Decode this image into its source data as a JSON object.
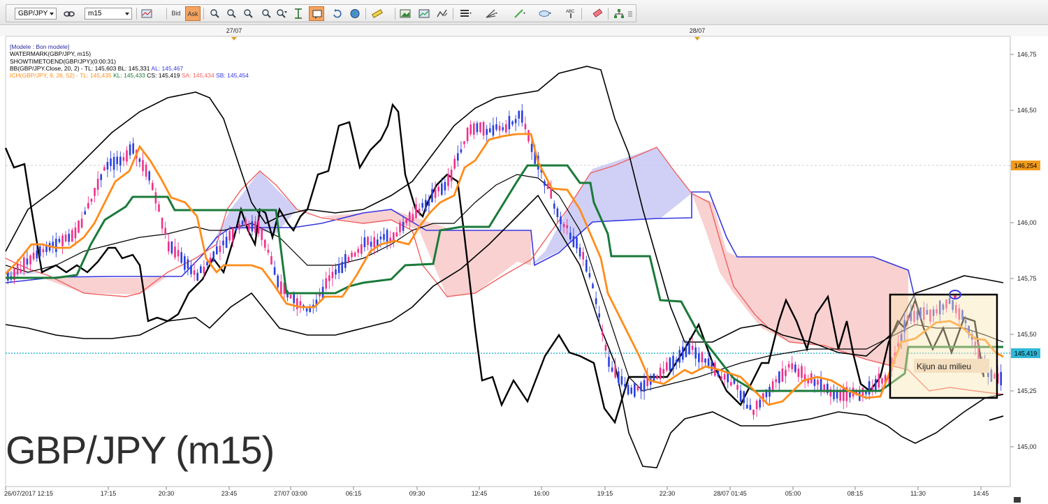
{
  "toolbar": {
    "symbol": "GBP/JPY",
    "timeframe": "m15",
    "bid_label": "Bid",
    "ask_label": "Ask"
  },
  "legend": {
    "line1": "[Modele : Bon modele]",
    "line2": "WATERMARK(GBP/JPY, m15)",
    "line3": "SHOWTIMETOEND(GBP/JPY)(0:00:31)",
    "bb_prefix": "BB(GBP/JPY.Close, 20, 2) -  TL: 145,603  BL: 145,331",
    "bb_al": "AL: 145,467",
    "ich_prefix": "ICH(GBP/JPY, 9, 26, 52) -  TL: 145,435",
    "ich_kl": "KL: 145,433",
    "ich_cs": "CS: 145,419",
    "ich_sa": "SA: 145,434",
    "ich_sb": "SB: 145,454"
  },
  "watermark": "GBP/JPY (m15)",
  "annotation": "Kijun au milieu",
  "date_markers": [
    "27/07",
    "28/07"
  ],
  "price_axis": [
    "146,75",
    "146,50",
    "146,25",
    "146,00",
    "145,75",
    "145,50",
    "145,25",
    "145,00"
  ],
  "price_tags": {
    "high": "146,254",
    "current": "145,419"
  },
  "time_axis": [
    "26/07/2017 12:15",
    "17:15",
    "20:30",
    "23:45",
    "27/07 03:00",
    "06:15",
    "09:30",
    "12:45",
    "16:00",
    "19:15",
    "22:30",
    "28/07 01:45",
    "05:00",
    "08:15",
    "11:30",
    "14:45"
  ],
  "colors": {
    "tenkan": "#ff8c1a",
    "kijun": "#1a7a3a",
    "senkou_a": "#f06060",
    "senkou_b": "#3838e0",
    "bollinger": "#000000",
    "bull": "#2a40e0",
    "bear": "#f0308a",
    "bb_al": "#3838e0",
    "ich_kl": "#1a7a3a",
    "ich_sa": "#f06060"
  }
}
